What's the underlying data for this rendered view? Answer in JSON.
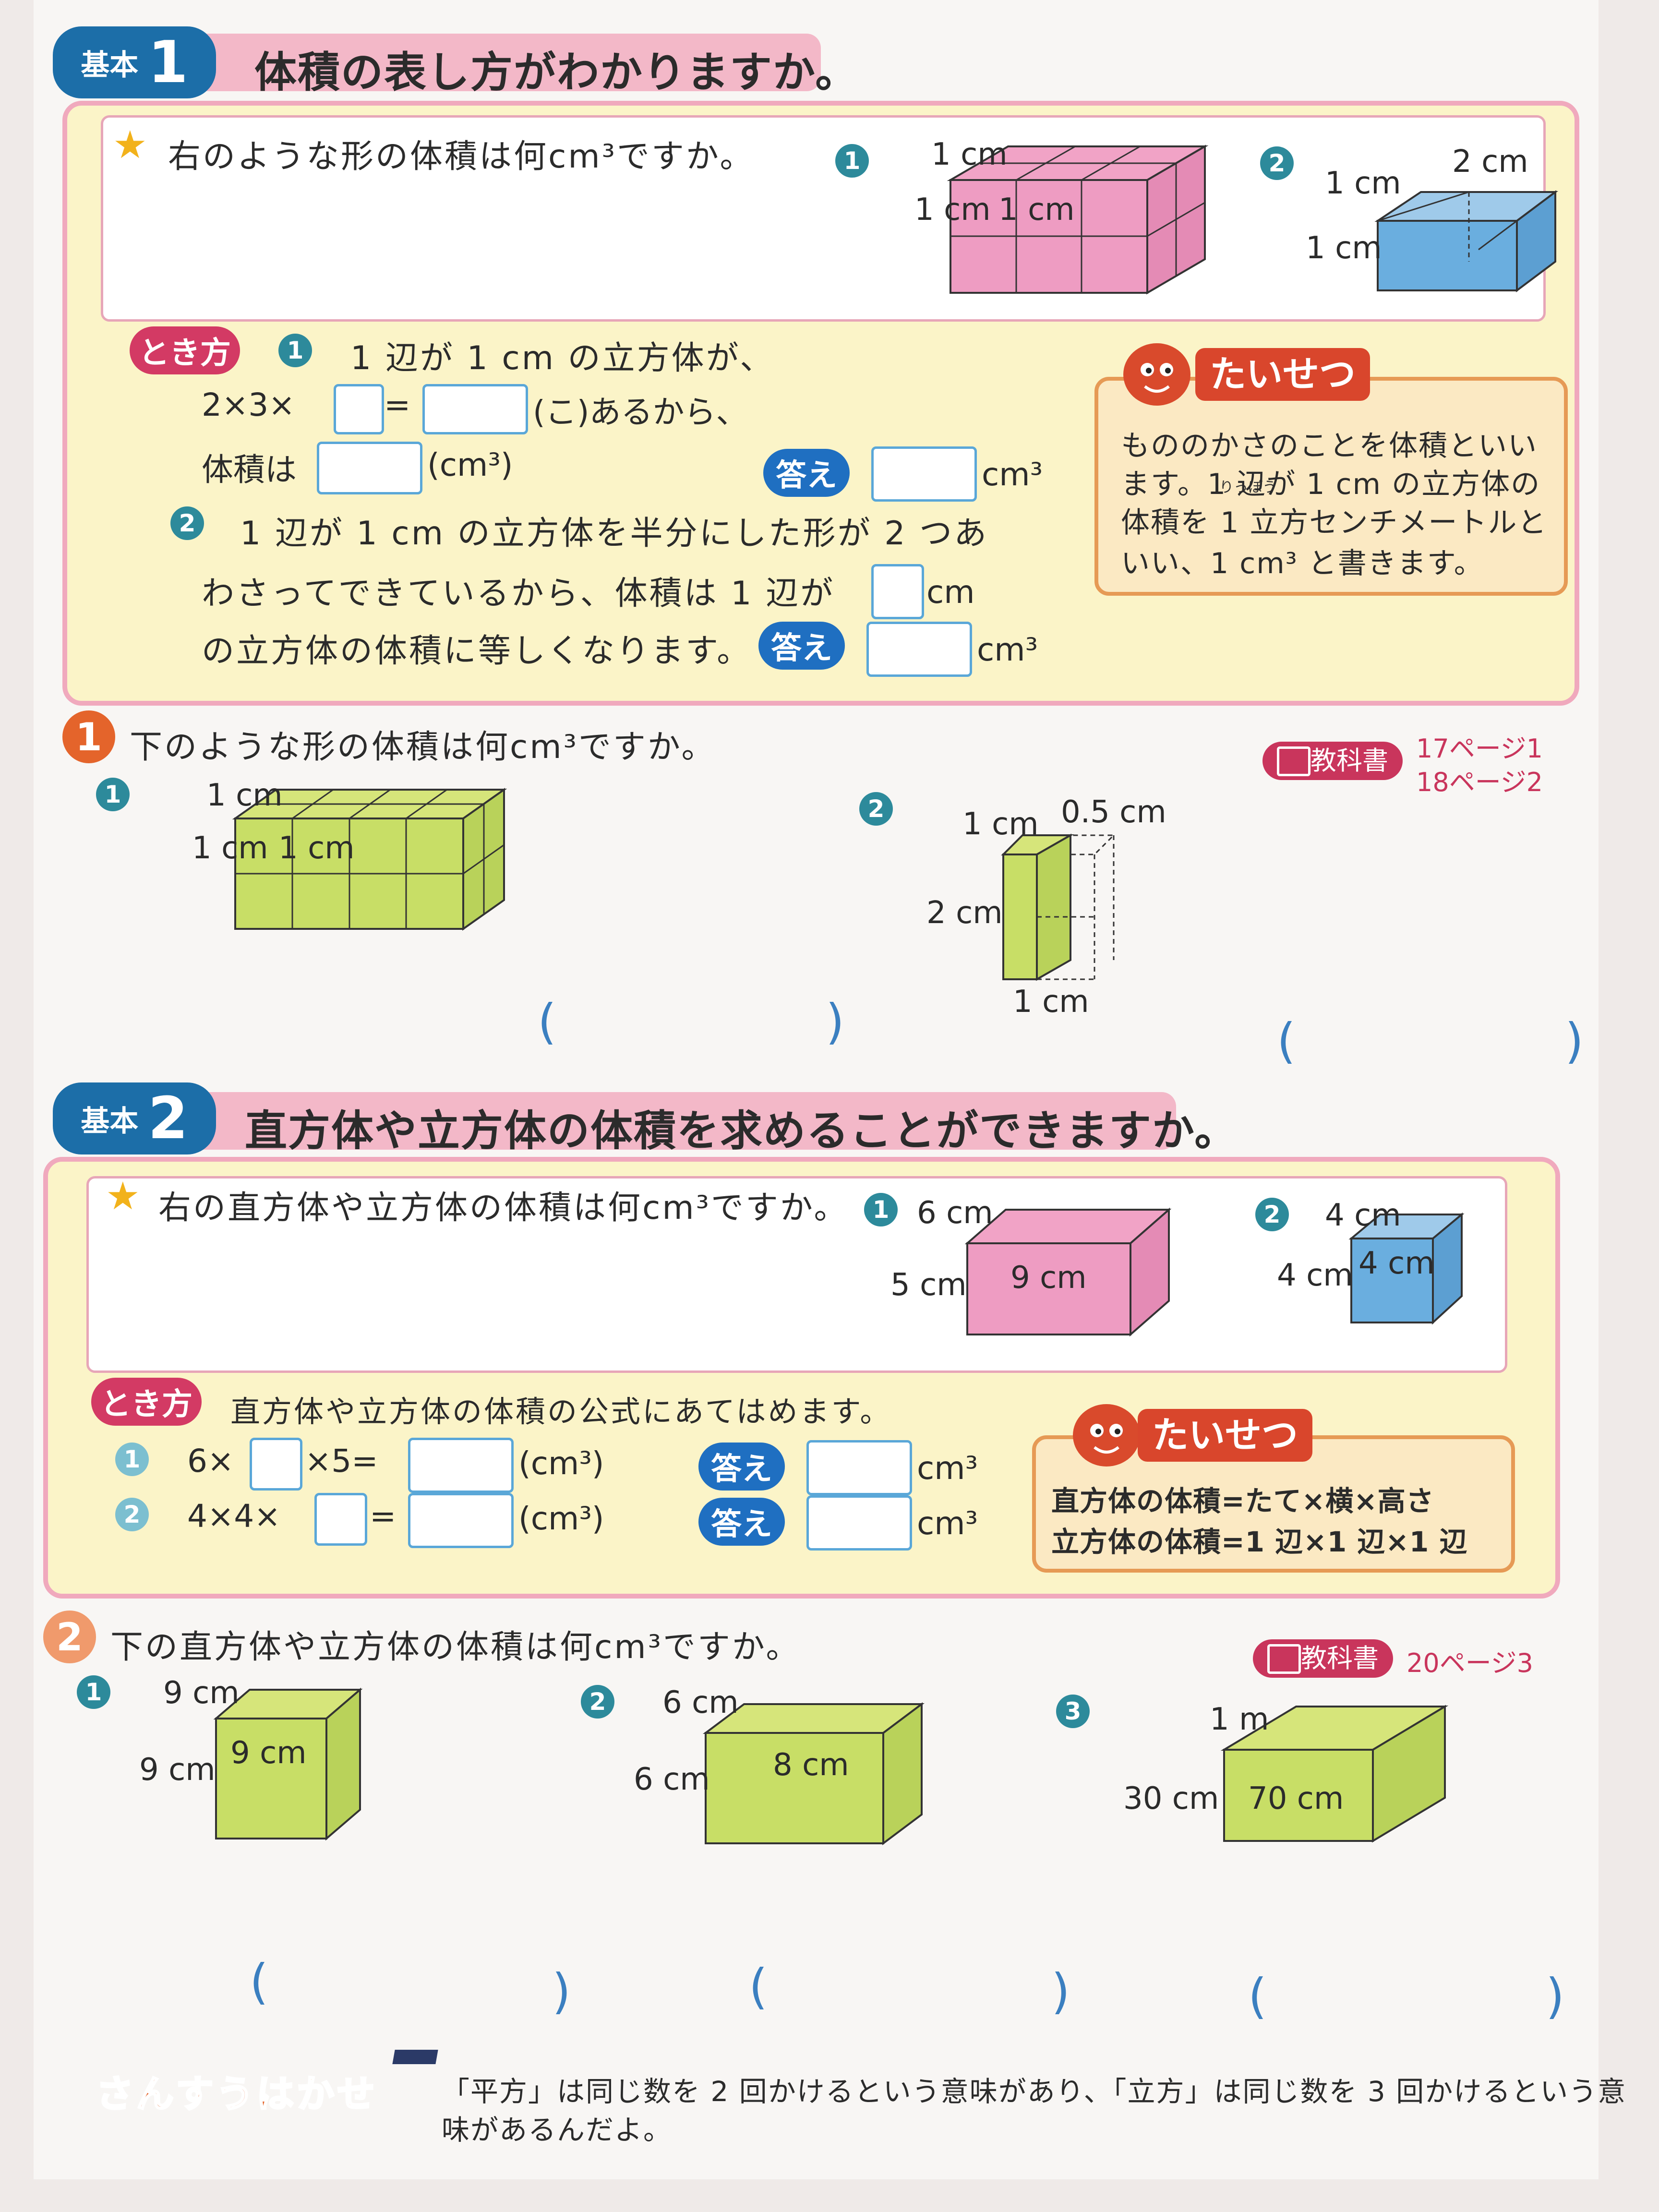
{
  "section1": {
    "kihon_label": "基本",
    "number": "1",
    "title": "体積の表し方がわかりますか。",
    "question": "右のような形の体積は何cm³ですか。",
    "fig1_no": "1",
    "fig1_labels": [
      "1 cm",
      "1 cm",
      "1 cm"
    ],
    "fig2_no": "2",
    "fig2_labels": [
      "2 cm",
      "1 cm",
      "1 cm"
    ],
    "tokikata_label": "とき方",
    "line1": "1 辺が 1 cm の立方体が、",
    "line2a": "2×3×",
    "line2b": "=",
    "line2c": "(こ)あるから、",
    "line3a": "体積は",
    "line3b": "(cm³)",
    "kotae_label": "答え",
    "unit": "cm³",
    "line4": "1 辺が 1 cm の立方体を半分にした形が 2 つあ",
    "line5a": "わさってできているから、体積は 1 辺が",
    "line5b": "cm",
    "line6": "の立方体の体積に等しくなります。",
    "taisetsu_label": "たいせつ",
    "taisetsu_lines": [
      "もののかさのことを体積といい",
      "ます。1 辺が 1 cm の立方体の",
      "体積を 1 立方センチメートルと",
      "いい、1 cm³ と書きます。"
    ],
    "ruby": "りっぽう"
  },
  "q1": {
    "number": "1",
    "question": "下のような形の体積は何cm³ですか。",
    "textbook_label": "教科書",
    "pages": [
      "17ページ1",
      "18ページ2"
    ],
    "fig1_labels": [
      "1 cm",
      "1 cm",
      "1 cm"
    ],
    "fig2_labels": [
      "1 cm",
      "0.5 cm",
      "2 cm",
      "1 cm"
    ],
    "paren_open": "(",
    "paren_close": ")"
  },
  "section2": {
    "kihon_label": "基本",
    "number": "2",
    "title": "直方体や立方体の体積を求めることができますか。",
    "question": "右の直方体や立方体の体積は何cm³ですか。",
    "fig1_labels": [
      "6 cm",
      "5 cm",
      "9 cm"
    ],
    "fig2_labels": [
      "4 cm",
      "4 cm",
      "4 cm"
    ],
    "tokikata_label": "とき方",
    "intro": "直方体や立方体の体積の公式にあてはめます。",
    "row1a": "6×",
    "row1b": "×5=",
    "row2a": "4×4×",
    "row2b": "=",
    "cm3paren": "(cm³)",
    "kotae_label": "答え",
    "unit": "cm³",
    "taisetsu_label": "たいせつ",
    "taisetsu_lines": [
      "直方体の体積=たて×横×高さ",
      "立方体の体積=1 辺×1 辺×1 辺"
    ]
  },
  "q2": {
    "number": "2",
    "question": "下の直方体や立方体の体積は何cm³ですか。",
    "textbook_label": "教科書",
    "pages": "20ページ3",
    "fig1_labels": [
      "9 cm",
      "9 cm",
      "9 cm"
    ],
    "fig2_labels": [
      "6 cm",
      "6 cm",
      "8 cm"
    ],
    "fig3_labels": [
      "1 m",
      "30 cm",
      "70 cm"
    ],
    "paren_open": "(",
    "paren_close": ")"
  },
  "footer": {
    "logo": "さんすうはかせ",
    "line1": "「平方」は同じ数を 2 回かけるという意味があり、「立方」は同じ数を 3 回かけるという意",
    "line2": "味があるんだよ。"
  },
  "colors": {
    "pink": "#e98fb3",
    "blue": "#69a9dc",
    "green": "#c6dd62",
    "accent": "#1f6fc1"
  }
}
